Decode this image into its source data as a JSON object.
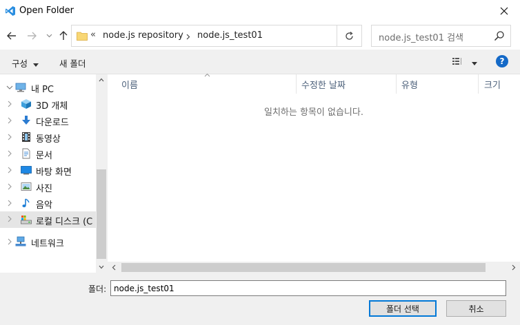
{
  "window": {
    "title": "Open Folder"
  },
  "address": {
    "overflow": "«",
    "crumbs": [
      "node.js repository",
      "node.js_test01"
    ]
  },
  "search": {
    "placeholder": "node.js_test01 검색"
  },
  "toolbar": {
    "organize": "구성",
    "new_folder": "새 폴더",
    "help": "?"
  },
  "sidebar": {
    "items": [
      {
        "label": "내 PC",
        "icon": "pc-icon"
      },
      {
        "label": "3D 개체",
        "icon": "cube-3d-icon"
      },
      {
        "label": "다운로드",
        "icon": "download-icon"
      },
      {
        "label": "동영상",
        "icon": "video-icon"
      },
      {
        "label": "문서",
        "icon": "document-icon"
      },
      {
        "label": "바탕 화면",
        "icon": "desktop-icon"
      },
      {
        "label": "사진",
        "icon": "pictures-icon"
      },
      {
        "label": "음악",
        "icon": "music-icon"
      },
      {
        "label": "로컬 디스크 (C",
        "icon": "drive-icon"
      },
      {
        "label": "네트워크",
        "icon": "network-icon"
      }
    ]
  },
  "content": {
    "columns": [
      "이름",
      "수정한 날짜",
      "유형",
      "크기"
    ],
    "empty_message": "일치하는 항목이 없습니다."
  },
  "footer": {
    "folder_label": "폴더:",
    "folder_value": "node.js_test01",
    "select_button": "폴더 선택",
    "cancel_button": "취소"
  },
  "colors": {
    "accent": "#0078d7",
    "help_bg": "#1469c7",
    "folder_yellow": "#f8d775"
  }
}
